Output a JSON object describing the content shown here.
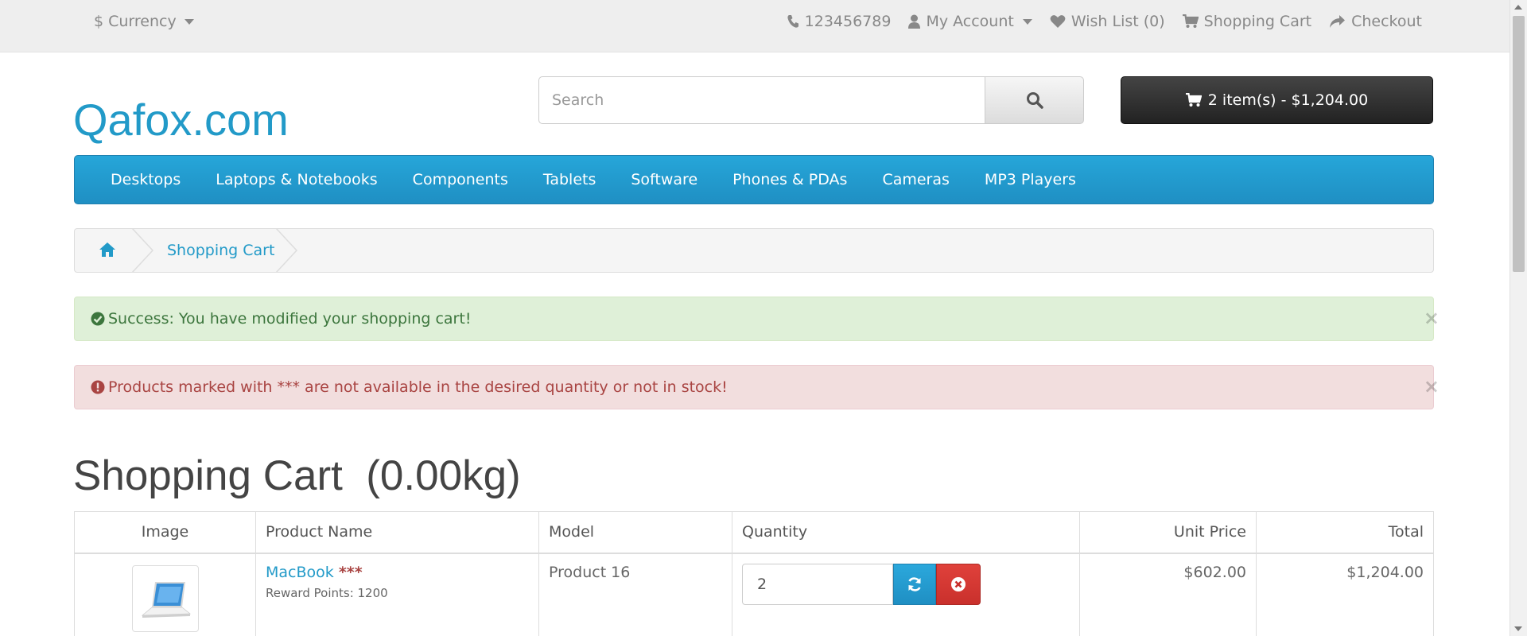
{
  "topbar": {
    "currency_symbol": "$",
    "currency_label": "Currency",
    "phone": "123456789",
    "my_account": "My Account",
    "wishlist": "Wish List (0)",
    "shopping_cart": "Shopping Cart",
    "checkout": "Checkout"
  },
  "header": {
    "logo": "Qafox.com",
    "search_placeholder": "Search",
    "cart_button": "2 item(s) - $1,204.00"
  },
  "menu": {
    "items": [
      "Desktops",
      "Laptops & Notebooks",
      "Components",
      "Tablets",
      "Software",
      "Phones & PDAs",
      "Cameras",
      "MP3 Players"
    ]
  },
  "breadcrumb": {
    "current": "Shopping Cart"
  },
  "alerts": {
    "success": "Success: You have modified your shopping cart!",
    "danger": "Products marked with *** are not available in the desired quantity or not in stock!",
    "close_glyph": "×"
  },
  "page": {
    "title": "Shopping Cart  (0.00kg)"
  },
  "table": {
    "headers": {
      "image": "Image",
      "product_name": "Product Name",
      "model": "Model",
      "quantity": "Quantity",
      "unit_price": "Unit Price",
      "total": "Total"
    },
    "rows": [
      {
        "product_name": "MacBook",
        "stock_marker": "***",
        "reward": "Reward Points: 1200",
        "model": "Product 16",
        "quantity": "2",
        "unit_price": "$602.00",
        "total": "$1,204.00"
      }
    ]
  },
  "colors": {
    "brand_blue": "#229ac8",
    "menu_blue": "#229ac8",
    "success_bg": "#dff0d8",
    "danger_bg": "#f2dede",
    "remove_red": "#c9302c"
  }
}
